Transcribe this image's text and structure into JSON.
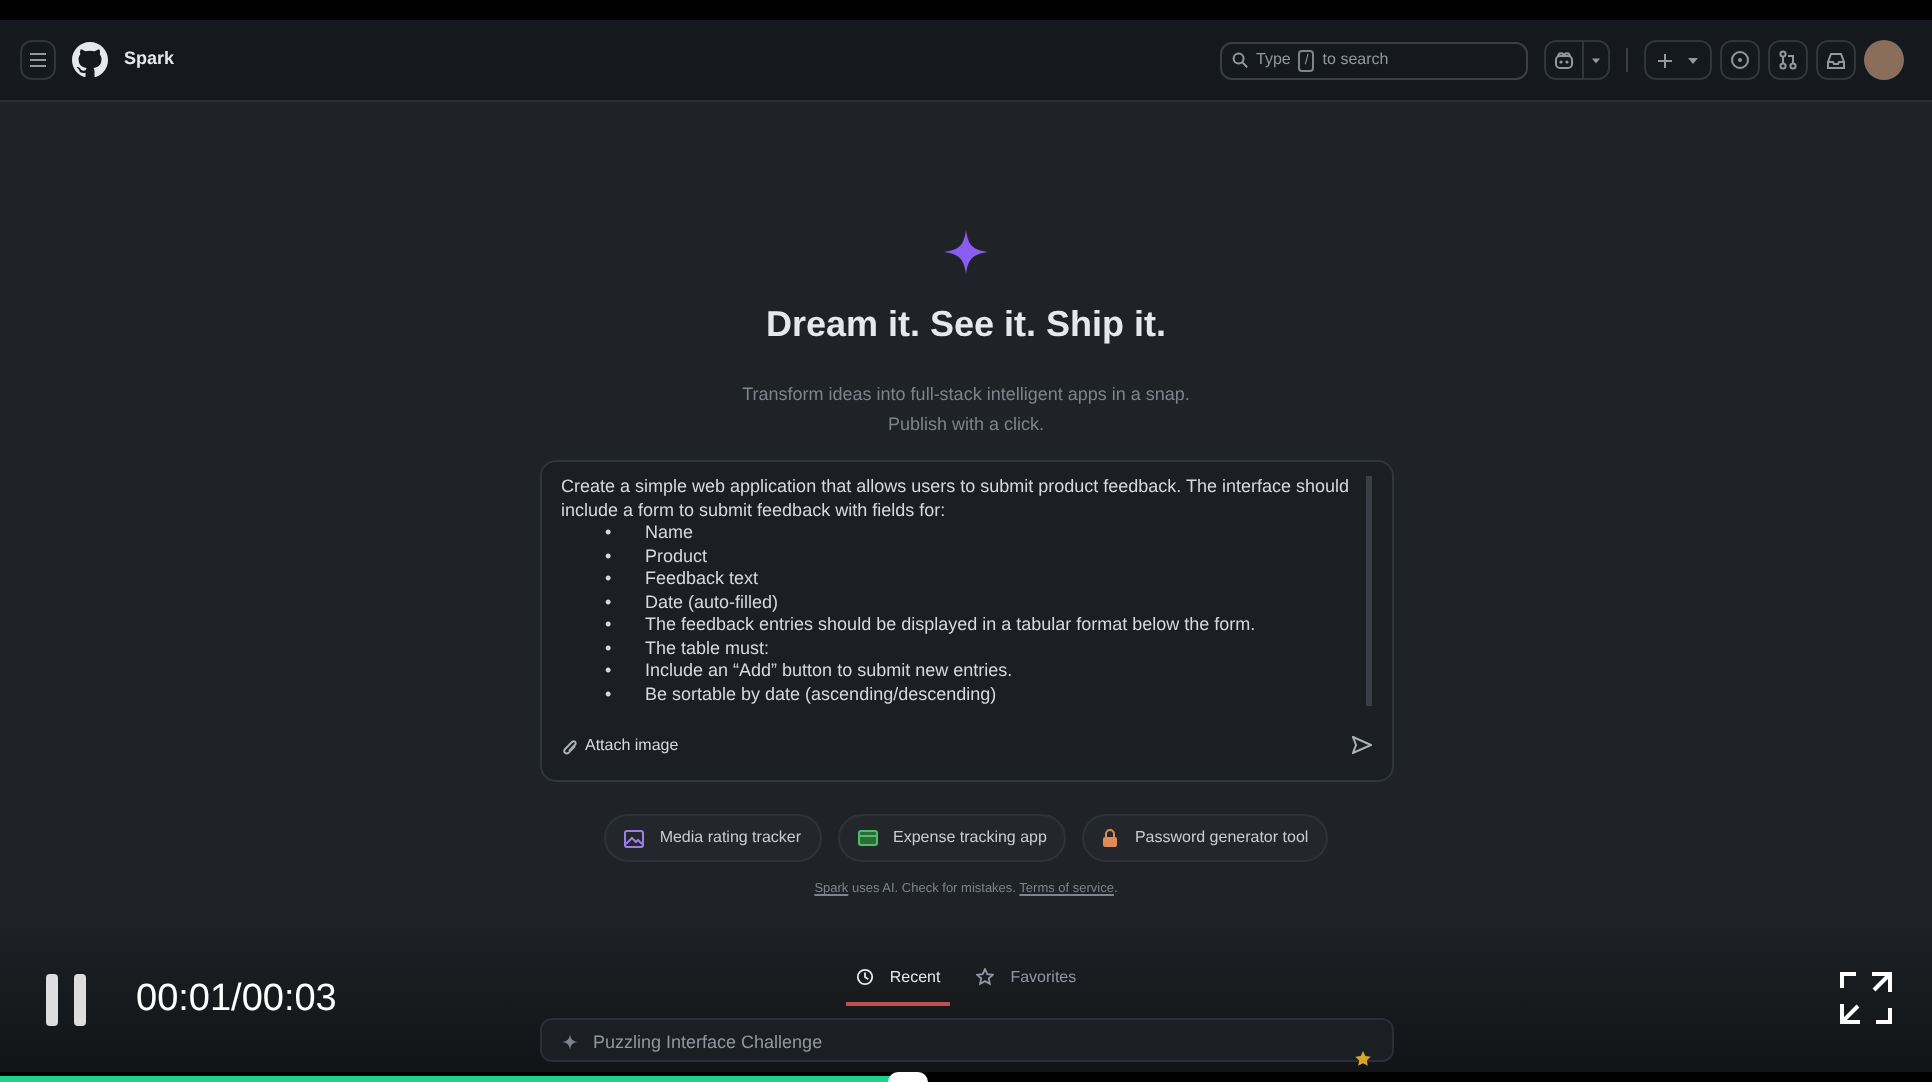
{
  "header": {
    "app_name": "Spark",
    "search": {
      "prefix": "Type",
      "key": "/",
      "suffix": "to search"
    }
  },
  "hero": {
    "title": "Dream it. See it. Ship it.",
    "subtitle": [
      "Transform ideas into full-stack intelligent apps in a snap.",
      "Publish with a click."
    ]
  },
  "prompt": {
    "intro": "Create a simple web application that allows users to submit product feedback. The interface should include a form to submit feedback with fields for:",
    "items": [
      {
        "marker": "•",
        "text": "Name"
      },
      {
        "marker": "•",
        "text": "Product"
      },
      {
        "marker": "•",
        "text": "Feedback text"
      },
      {
        "marker": "•",
        "text": "Date (auto-filled)"
      },
      {
        "marker": "•",
        "text": "The feedback entries should be displayed in a tabular format below the form."
      },
      {
        "marker": "•",
        "text": "The table must:"
      },
      {
        "marker": "•",
        "text": "Include an “Add” button to submit new entries."
      },
      {
        "marker": "•",
        "text": "Be sortable by date (ascending/descending)"
      }
    ],
    "attach_label": "Attach image"
  },
  "suggestions": [
    {
      "label": "Media rating tracker",
      "kind": "media"
    },
    {
      "label": "Expense tracking app",
      "kind": "expense"
    },
    {
      "label": "Password generator tool",
      "kind": "password"
    }
  ],
  "disclaimer": {
    "link": "Spark",
    "text": " uses AI. Check for mistakes. ",
    "terms": "Terms of service",
    "end": "."
  },
  "tabs": [
    {
      "label": "Recent",
      "kind": "recent",
      "selected": true
    },
    {
      "label": "Favorites",
      "kind": "favorites",
      "selected": false
    }
  ],
  "recent": [
    {
      "title": "Puzzling Interface Challenge",
      "starred": true
    }
  ],
  "video": {
    "playing": true,
    "time": "00:01/00:03",
    "level": 0.47
  }
}
